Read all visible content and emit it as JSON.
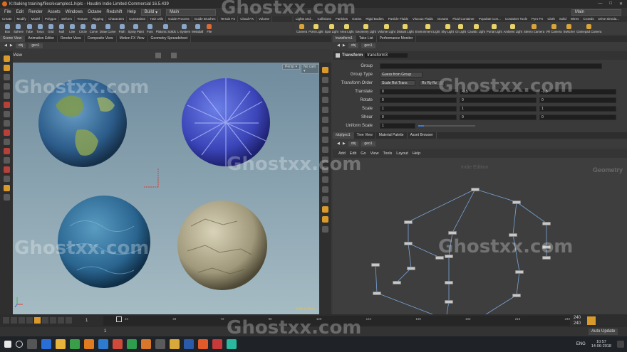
{
  "window": {
    "title": "K:/baking training/files/examples1.hiplc - Houdini Indie Limited-Commercial 16.5.439",
    "min": "—",
    "max": "□",
    "close": "✕"
  },
  "menu": {
    "items": [
      "File",
      "Edit",
      "Render",
      "Assets",
      "Windows",
      "Octane",
      "Redshift",
      "Help"
    ],
    "build": "Build",
    "main": "Main",
    "main2": "Main"
  },
  "shelf": {
    "tabs": [
      "Create",
      "Modify",
      "Model",
      "Polygon",
      "Deform",
      "Texture",
      "Rigging",
      "Characters",
      "Constraints",
      "Hair Utils",
      "Guide Process",
      "Guide Brushes",
      "Terrain FX",
      "Cloud FX",
      "Volume"
    ],
    "tabs2": [
      "Lights and...",
      "Collisions",
      "Particles",
      "Grains",
      "Rigid Bodies",
      "Particle Fluids",
      "Viscous Fluids",
      "Oceans",
      "Fluid Container",
      "Populate Con...",
      "Container Tools",
      "Pyro FX",
      "Cloth",
      "Solid",
      "Wires",
      "Crowds",
      "Drive Simula..."
    ],
    "tools": [
      "Box",
      "Sphere",
      "Tube",
      "Torus",
      "Grid",
      "Null",
      "Line",
      "Circle",
      "Curve",
      "Draw Curve",
      "Path",
      "Spray Paint",
      "Font",
      "Platonic Solids",
      "L-System",
      "Metaball",
      "File"
    ],
    "tools2": [
      "Camera",
      "Point Light",
      "Spot Light",
      "Area Light",
      "Geometry Light",
      "Volume Light",
      "Distant Light",
      "Environment Light",
      "Sky Light",
      "GI Light",
      "Caustic Light",
      "Portal Light",
      "Ambient Light",
      "Stereo Camera",
      "VR Camera",
      "Switcher",
      "Gamepad Camera"
    ]
  },
  "left_panel": {
    "tabs": [
      "Scene View",
      "Animation Editor",
      "Render View",
      "Composite View",
      "Motion FX View",
      "Geometry Spreadsheet"
    ],
    "path": [
      "obj",
      "geo1"
    ],
    "view_label": "View",
    "persp": "Persp ▾",
    "nocam": "No cam ▾",
    "indie": "Indie Edition"
  },
  "params": {
    "tabs": [
      "transform1",
      "Take List",
      "Performance Monitor"
    ],
    "path": [
      "obj",
      "geo1"
    ],
    "node_type": "Transform",
    "node_name": "transform3",
    "group_label": "Group",
    "grouptype_label": "Group Type",
    "grouptype_val": "Guess from Group",
    "xord_label": "Transform Order",
    "xord_val": "Scale Rot Trans",
    "rord_val": "Rx Ry Rz",
    "translate_label": "Translate",
    "translate": [
      "0",
      "-1.5",
      "-1.5"
    ],
    "rotate_label": "Rotate",
    "rotate": [
      "0",
      "0",
      "0"
    ],
    "scale_label": "Scale",
    "scale": [
      "1",
      "1",
      "1"
    ],
    "shear_label": "Shear",
    "shear": [
      "0",
      "0",
      "0"
    ],
    "uniform_label": "Uniform Scale",
    "uniform": "1"
  },
  "network": {
    "tabs": [
      "/obj/geo1",
      "Tree View",
      "Material Palette",
      "Asset Browser"
    ],
    "path": [
      "obj",
      "geo1"
    ],
    "menu": [
      "Add",
      "Edit",
      "Go",
      "View",
      "Tools",
      "Layout",
      "Help"
    ],
    "indie": "Indie Edition",
    "context": "Geometry"
  },
  "timeline": {
    "ticks": [
      "1",
      "24",
      "48",
      "72",
      "96",
      "120",
      "144",
      "168",
      "192",
      "216",
      "240"
    ],
    "frame": "1",
    "start": "1",
    "end": "240",
    "end2": "240"
  },
  "bottom": {
    "auto_update": "Auto Update"
  },
  "taskbar": {
    "time": "10:57",
    "date": "14-06-2018",
    "lang": "ENG"
  },
  "watermark": "Ghostxx.com"
}
